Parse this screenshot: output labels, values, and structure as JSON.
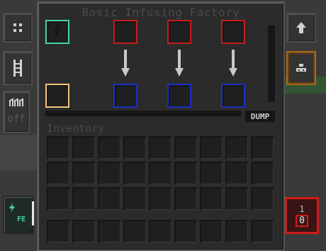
{
  "machine": {
    "title": "Basic Infusing Factory",
    "dump_label": "DUMP",
    "inventory_label": "Inventory",
    "redstone_state": "off",
    "energy_unit": "FE",
    "counter_top": "1",
    "counter_bottom": "0"
  },
  "colors": {
    "energy_slot": "#4ad49a",
    "infuse_slot": "#f2c57a",
    "input_slot": "#c21d1d",
    "output_slot": "#1d2fc2",
    "counter_red": "#d11b1b"
  },
  "icons": {
    "left_buttons": [
      "grid-icon",
      "ladder-icon",
      "redstone-icon"
    ],
    "right_buttons": [
      "upgrade-arrow-icon",
      "config-icon"
    ],
    "energy": "lightning-icon"
  }
}
